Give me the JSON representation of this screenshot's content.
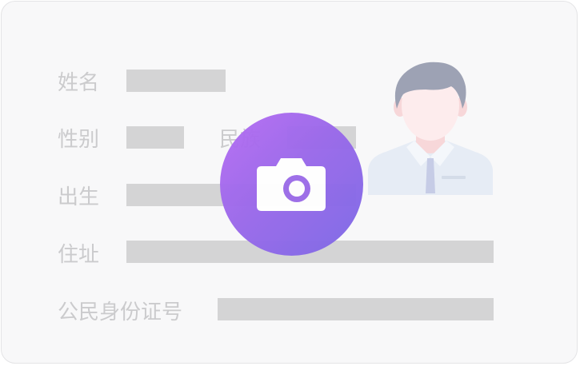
{
  "card": {
    "labels": {
      "name": "姓名",
      "gender": "性别",
      "ethnicity": "民族",
      "birth": "出生",
      "address": "住址",
      "id_number": "公民身份证号"
    }
  },
  "icons": {
    "portrait": "person-silhouette-icon",
    "camera": "camera-icon"
  },
  "colors": {
    "card_bg": "#f8f8f9",
    "label_text": "#cbcbcd",
    "placeholder_bar": "#d4d4d5",
    "camera_gradient_start": "#b66cf3",
    "camera_gradient_end": "#7b68e6"
  }
}
